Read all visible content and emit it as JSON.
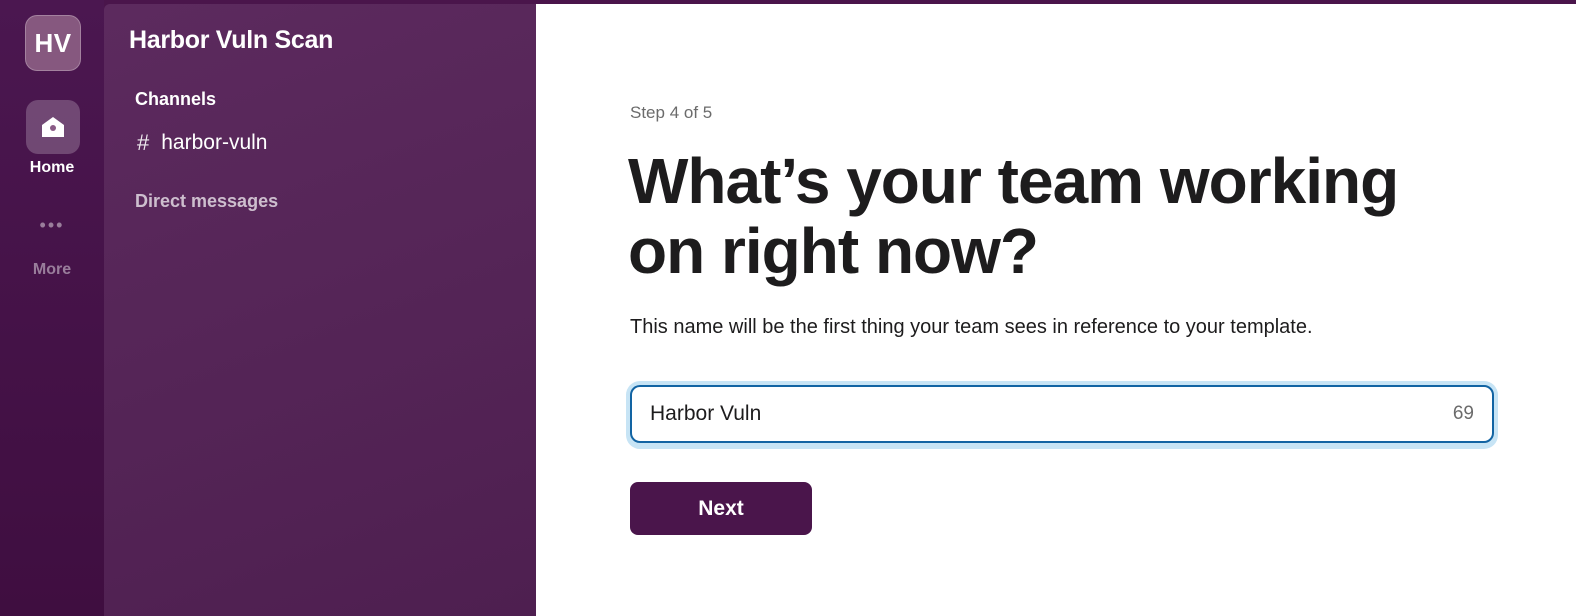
{
  "rail": {
    "workspace_initials": "HV",
    "home_label": "Home",
    "more_label": "More",
    "more_dots": "•••"
  },
  "sidebar": {
    "workspace_name": "Harbor Vuln Scan",
    "channels_title": "Channels",
    "channels": [
      {
        "prefix": "#",
        "name": "harbor-vuln"
      }
    ],
    "dm_title": "Direct messages"
  },
  "main": {
    "step": "Step 4 of 5",
    "heading_line1": "What’s your team working",
    "heading_line2": "on right now?",
    "description": "This name will be the first thing your team sees in reference to your template.",
    "input": {
      "value": "Harbor Vuln",
      "char_count": "69"
    },
    "next_label": "Next"
  },
  "colors": {
    "aubergine": "#4a154b",
    "focus_blue": "#1264a3",
    "focus_ring": "#c7e4f5"
  },
  "icons": {
    "home": "house-icon",
    "more": "ellipsis-icon",
    "channel": "hash-icon"
  }
}
